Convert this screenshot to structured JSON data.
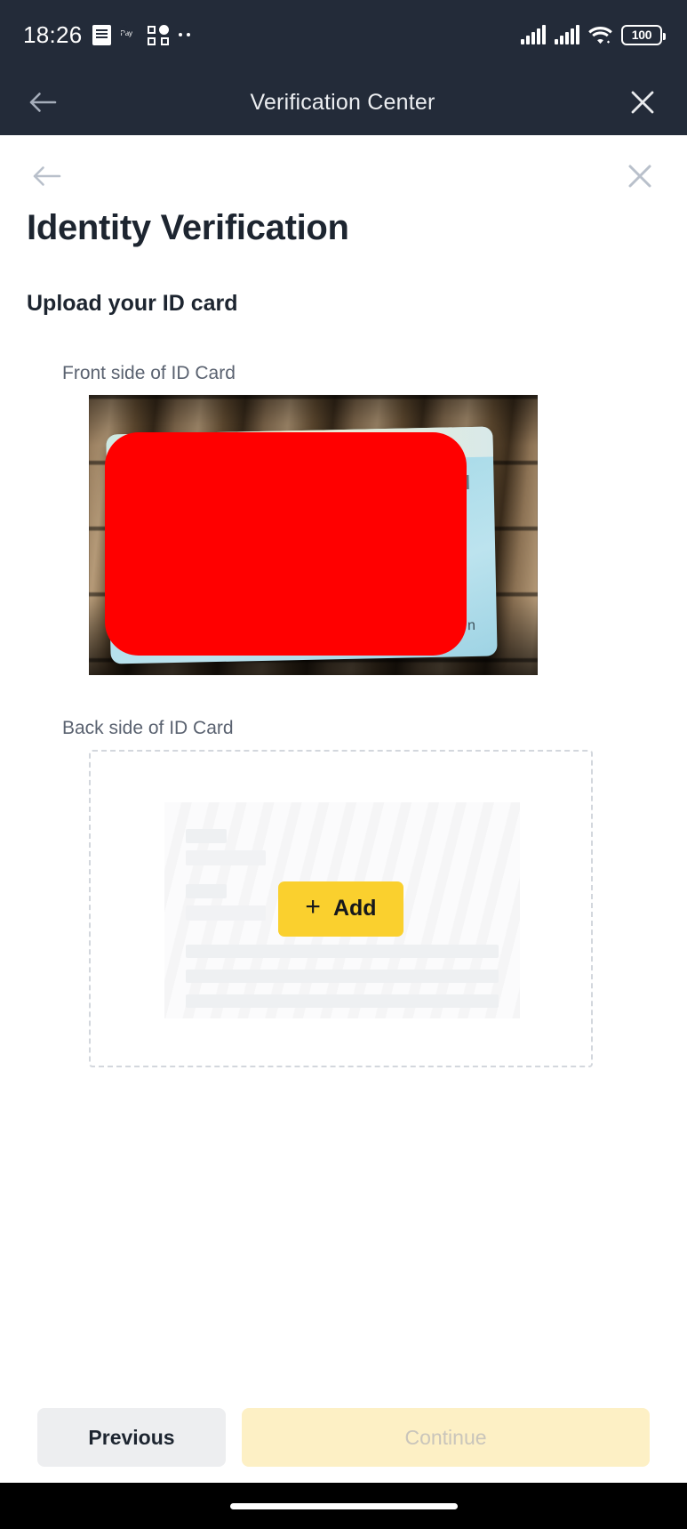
{
  "status_bar": {
    "time": "18:26",
    "battery_level": "100",
    "icons": [
      "document-icon",
      "samsung-pay-icon",
      "quick-panel-icon",
      "more-dots-icon",
      "signal-bars-icon",
      "signal-bars-2-icon",
      "wifi-icon",
      "battery-icon"
    ]
  },
  "app_bar": {
    "title": "Verification Center",
    "back_label": "Back",
    "close_label": "Close"
  },
  "page": {
    "title": "Identity Verification",
    "section_title": "Upload your ID card",
    "nav_back_label": "Back",
    "nav_close_label": "Close"
  },
  "front_side": {
    "label": "Front side of ID Card",
    "redaction_color": "#ff0000",
    "card_color": "#a9dbe9",
    "card_glyph": "n"
  },
  "back_side": {
    "label": "Back side of ID Card",
    "add_button": "Add",
    "add_icon": "+",
    "add_button_color": "#fad02e"
  },
  "footer": {
    "previous_label": "Previous",
    "continue_label": "Continue",
    "continue_disabled": true,
    "previous_color": "#edeef0",
    "continue_color": "#fdf0c5"
  }
}
